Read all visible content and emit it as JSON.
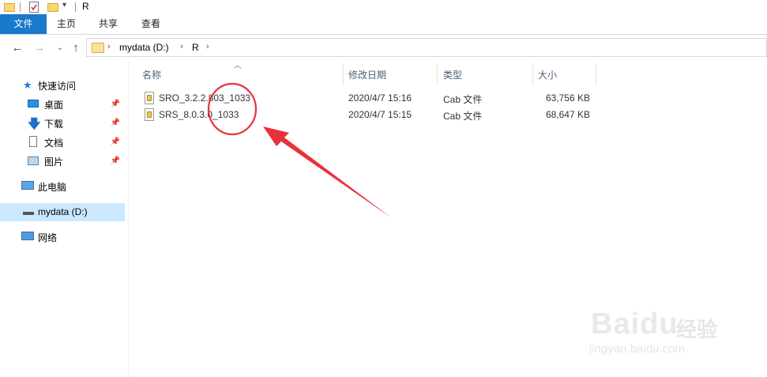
{
  "window": {
    "title": "R"
  },
  "ribbon": {
    "tabs": [
      {
        "label": "文件"
      },
      {
        "label": "主页"
      },
      {
        "label": "共享"
      },
      {
        "label": "查看"
      }
    ]
  },
  "address": {
    "breadcrumbs": [
      "mydata (D:)",
      "R"
    ]
  },
  "nav": {
    "quick_access": "快速访问",
    "items": [
      {
        "label": "桌面",
        "icon": "desktop-icon"
      },
      {
        "label": "下载",
        "icon": "download-icon"
      },
      {
        "label": "文档",
        "icon": "document-icon"
      },
      {
        "label": "图片",
        "icon": "picture-icon"
      }
    ],
    "this_pc": "此电脑",
    "drive": "mydata (D:)",
    "network": "网络"
  },
  "columns": {
    "name": "名称",
    "date": "修改日期",
    "type": "类型",
    "size": "大小"
  },
  "files": [
    {
      "name": "SRO_3.2.2.803_1033",
      "date": "2020/4/7 15:16",
      "type": "Cab 文件",
      "size": "63,756 KB"
    },
    {
      "name": "SRS_8.0.3.0_1033",
      "date": "2020/4/7 15:15",
      "type": "Cab 文件",
      "size": "68,647 KB"
    }
  ],
  "colors": {
    "accent": "#1979ca",
    "annotation": "#e8323a",
    "selected": "#cce8ff"
  },
  "watermark": {
    "logo": "Baidu",
    "cn": "经验",
    "url": "jingyan.baidu.com"
  }
}
